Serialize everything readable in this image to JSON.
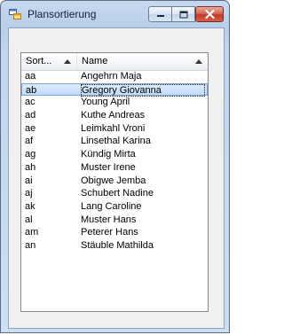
{
  "window": {
    "title": "Plansortierung",
    "icon": "app-window-icon",
    "buttons": {
      "minimize": "minimize-icon",
      "maximize": "maximize-icon",
      "close": "close-icon"
    }
  },
  "listview": {
    "columns": [
      {
        "label": "Sort...",
        "sort": "ascending"
      },
      {
        "label": "Name",
        "sort": "ascending"
      }
    ],
    "selected_index": 1,
    "rows": [
      {
        "sort": "aa",
        "name": "Angehrn Maja"
      },
      {
        "sort": "ab",
        "name": "Gregory Giovanna"
      },
      {
        "sort": "ac",
        "name": "Young April"
      },
      {
        "sort": "ad",
        "name": "Kuthe Andreas"
      },
      {
        "sort": "ae",
        "name": "Leimkahl Vroni"
      },
      {
        "sort": "af",
        "name": "Linsethal Karina"
      },
      {
        "sort": "ag",
        "name": "Kündig Mirta"
      },
      {
        "sort": "ah",
        "name": "Muster Irene"
      },
      {
        "sort": "ai",
        "name": "Obigwe Jemba"
      },
      {
        "sort": "aj",
        "name": "Schubert Nadine"
      },
      {
        "sort": "ak",
        "name": "Lang Caroline"
      },
      {
        "sort": "al",
        "name": "Muster Hans"
      },
      {
        "sort": "am",
        "name": "Peterer Hans"
      },
      {
        "sort": "an",
        "name": "Stäuble Mathilda"
      }
    ]
  },
  "colors": {
    "selection": "#c1dbfc",
    "selection_border": "#7da2ce",
    "close_button": "#c0392b"
  }
}
